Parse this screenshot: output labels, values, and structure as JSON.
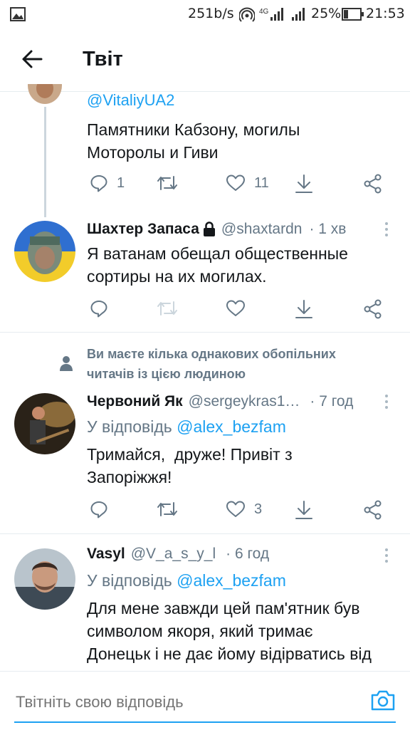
{
  "status_bar": {
    "net_speed": "251b/s",
    "network": "4G",
    "battery": "25%",
    "time": "21:53"
  },
  "header": {
    "title": "Твіт"
  },
  "tweets": [
    {
      "handle": "@VitaliyUA2",
      "text_lines": [
        "Памятники Кабзону, могилы",
        "Моторолы и Гиви"
      ],
      "reply_count": "1",
      "like_count": "11"
    },
    {
      "name": "Шахтер Запаса",
      "handle": "@shaxtardn",
      "time": "· 1 хв",
      "text_lines": [
        "Я ватанам обещал общественные",
        "сортиры на их могилах."
      ]
    },
    {
      "follow_note_lines": [
        "Ви маєте кілька однакових обопільних",
        "читачів із цією людиною"
      ],
      "name": "Червоний Як",
      "handle": "@sergeykras1…",
      "time": "· 7 год",
      "reply_prefix": "У відповідь",
      "reply_to": "@alex_bezfam",
      "text_lines": [
        "Тримайся,  друже! Привіт з",
        "Запоріжжя!"
      ],
      "like_count": "3"
    },
    {
      "name": "Vasyl",
      "handle": "@V_a_s_y_l",
      "time": "· 6 год",
      "reply_prefix": "У відповідь",
      "reply_to": "@alex_bezfam",
      "text_lines": [
        "Для мене завжди цей пам'ятник був",
        "символом якоря, який тримає",
        "Донецьк і не дає йому відірватись від"
      ]
    }
  ],
  "composer": {
    "placeholder": "Твітніть свою відповідь"
  },
  "colors": {
    "accent": "#1da1f2",
    "muted": "#657786",
    "divider": "#e6ecf0"
  }
}
